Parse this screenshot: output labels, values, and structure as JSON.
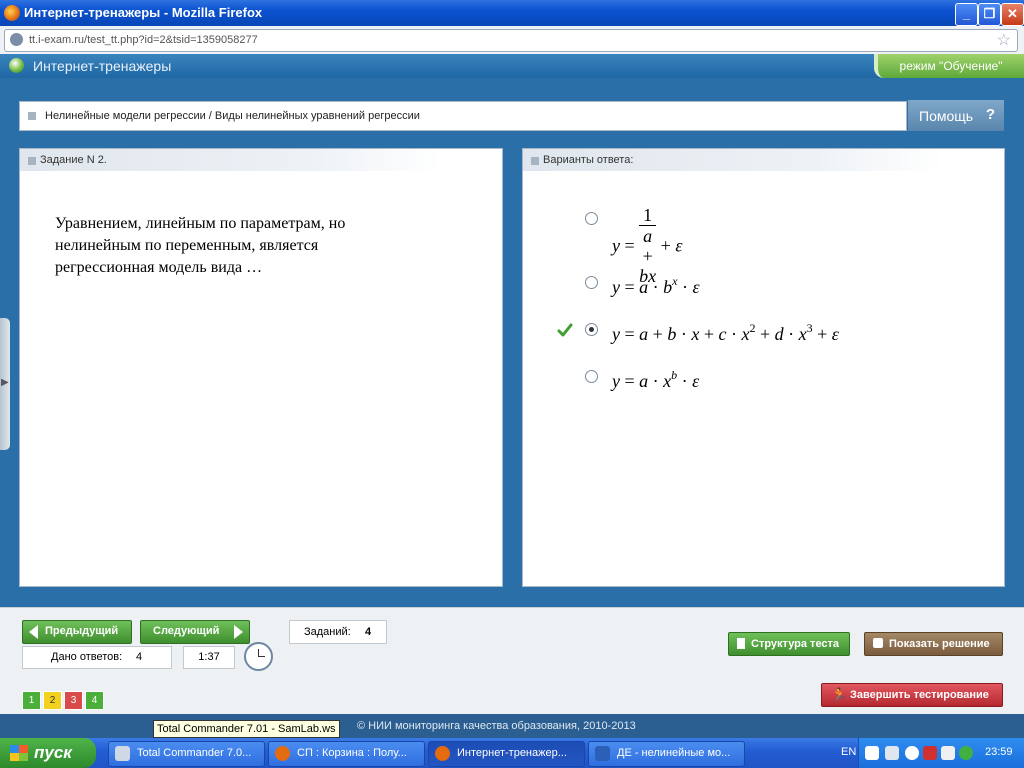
{
  "window": {
    "title": "Интернет-тренажеры - Mozilla Firefox",
    "minimize": "_",
    "maximize": "❐",
    "close": "✕"
  },
  "browser": {
    "url": "tt.i-exam.ru/test_tt.php?id=2&tsid=1359058277"
  },
  "app": {
    "name": "Интернет-тренажеры",
    "mode": "режим \"Обучение\""
  },
  "topic": {
    "text": "Нелинейные модели регрессии / Виды нелинейных уравнений регрессии",
    "help_label": "Помощь",
    "help_icon": "?"
  },
  "question": {
    "header": "Задание N 2.",
    "text": "Уравнением, линейным по параметрам, но нелинейным по переменным,  является регрессионная модель вида …"
  },
  "answers": {
    "header": "Варианты ответа:",
    "options": [
      {
        "formula": "y = 1/(a + bx) + ε",
        "selected": false
      },
      {
        "formula": "y = a · b^x · ε",
        "selected": false
      },
      {
        "formula": "y = a + b · x + c · x^2 + d · x^3 + ε",
        "selected": true
      },
      {
        "formula": "y = a · x^b · ε",
        "selected": false
      }
    ]
  },
  "nav": {
    "prev_label": "Предыдущий",
    "next_label": "Следующий",
    "tasks_label": "Заданий:",
    "tasks_count": "4",
    "answered_label": "Дано ответов:",
    "answered_count": "4",
    "timer": "1:37",
    "pages": [
      {
        "n": "1",
        "color": "#4caf3c"
      },
      {
        "n": "2",
        "color": "#f2d21f"
      },
      {
        "n": "3",
        "color": "#d94a4a"
      },
      {
        "n": "4",
        "color": "#4caf3c"
      }
    ],
    "structure_label": "Структура теста",
    "solution_label": "Показать решение",
    "finish_label": "Завершить тестирование"
  },
  "footer": {
    "copyright": "© НИИ мониторинга качества образования, 2010-2013",
    "tooltip": "Total Commander 7.01 - SamLab.ws"
  },
  "taskbar": {
    "start": "пуск",
    "tasks": [
      {
        "label": "Total Commander 7.0...",
        "icon_color": "#e8e8e8"
      },
      {
        "label": "СП : Корзина : Полу...",
        "icon_color": "#e56b10"
      },
      {
        "label": "Интернет-тренажер...",
        "icon_color": "#e56b10"
      },
      {
        "label": "ДЕ - нелинейные мо...",
        "icon_color": "#2b5fb8"
      }
    ],
    "lang": "EN",
    "time": "23:59"
  },
  "colors": {
    "accent_blue": "#2a6fa8",
    "green_button": "#4caf3c",
    "brown_button": "#8a6a4a",
    "red_button": "#c9323a"
  }
}
